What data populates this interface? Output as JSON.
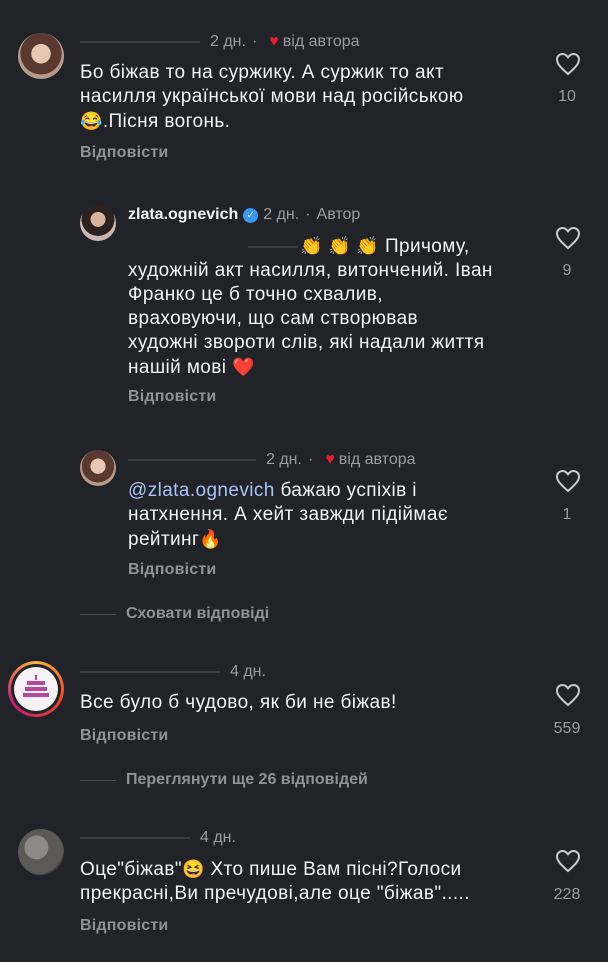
{
  "comments": [
    {
      "time": "2 дн.",
      "liked_by_author": "від автора",
      "text": "Бо біжав то на суржику. А суржик то акт насилля української мови над російською 😂.Пісня вогонь.",
      "line1": "Бо біжав то на суржику. А суржик то акт",
      "line2": "насилля української мови над російською",
      "line3_emoji": "😂",
      "line3": ".Пісня вогонь.",
      "reply_label": "Відповісти",
      "likes": "10"
    },
    {
      "username": "zlata.ognevich",
      "time": "2 дн.",
      "author_label": "Автор",
      "emojis": "👏 👏 👏",
      "line1": "Причому,",
      "line2": "художній акт насилля, витончений. Іван",
      "line3": "Франко це б точно схвалив,",
      "line4": "враховуючи, що сам створював",
      "line5": "художні звороти слів, які надали життя",
      "line6": "нашій мові",
      "heart_emoji": "❤️",
      "reply_label": "Відповісти",
      "likes": "9"
    },
    {
      "time": "2 дн.",
      "liked_by_author": "від автора",
      "mention": "@zlata.ognevich",
      "line1": "бажаю успіхів і",
      "line2": "натхнення. А хейт завжди підіймає",
      "line3": "рейтинг",
      "fire_emoji": "🔥",
      "reply_label": "Відповісти",
      "likes": "1"
    },
    {
      "time": "4 дн.",
      "text": "Все було б чудово, як би не біжав!",
      "reply_label": "Відповісти",
      "likes": "559"
    },
    {
      "time": "4 дн.",
      "line1_a": "Оце\"біжав\"",
      "line1_emoji": "😆",
      "line1_b": "Хто пише Вам пісні?Голоси",
      "line2": "прекрасні,Ви пречудові,але оце \"біжав\".....",
      "reply_label": "Відповісти",
      "likes": "228"
    }
  ],
  "hide_replies": "Сховати відповіді",
  "view_more_replies": "Переглянути ще 26 відповідей",
  "colors": {
    "background": "#212328",
    "heart_red": "#e0202a",
    "verified_blue": "#3897f0",
    "mention_blue": "#a8c4f5"
  }
}
